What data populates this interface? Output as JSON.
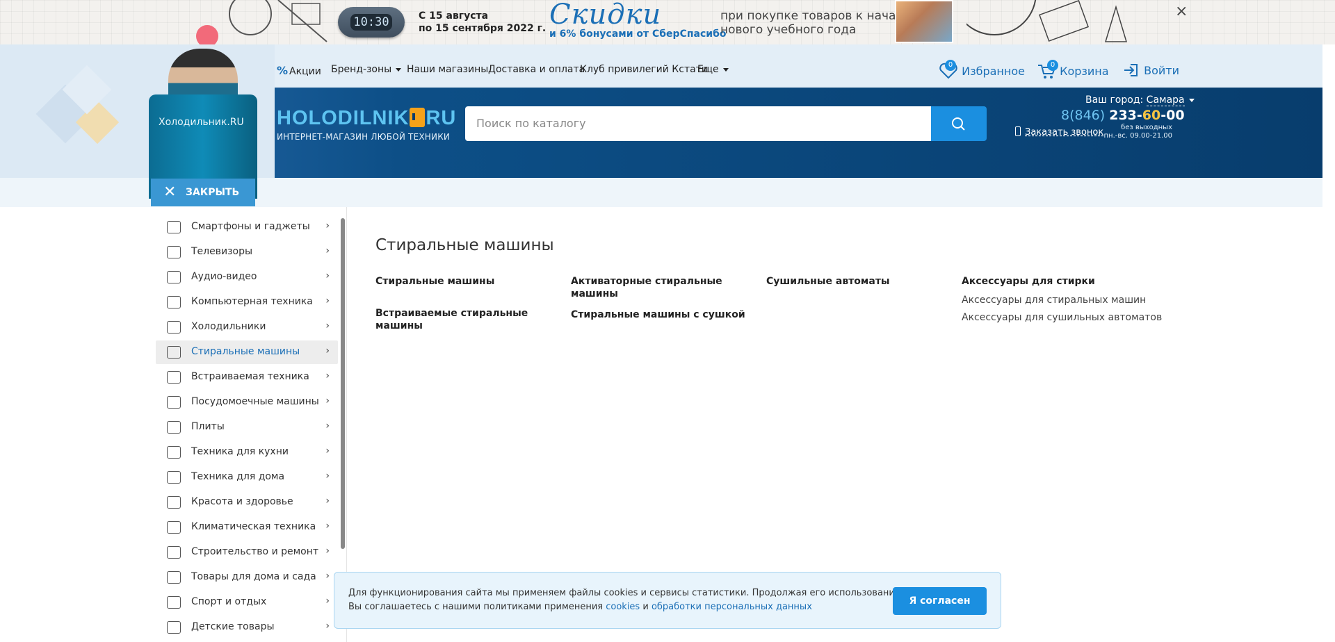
{
  "promo": {
    "clock_time": "10:30",
    "dates_line1": "С 15 августа",
    "dates_line2": "по 15 сентября 2022 г.",
    "sale_word": "Скидки",
    "bonus_text": "и 6% бонусами от СберСпасибо",
    "note_line1": "при покупке товаров к началу",
    "note_line2": "нового учебного года",
    "close": "×"
  },
  "illustration": {
    "fridge_label": "Холодильник.RU"
  },
  "topnav": {
    "items": [
      {
        "label": "Акции",
        "icon": "percent-icon"
      },
      {
        "label": "Бренд-зоны",
        "dropdown": true
      },
      {
        "label": "Наши магазины"
      },
      {
        "label": "Доставка и оплата"
      },
      {
        "label": "Клуб привилегий Кстати"
      },
      {
        "label": "Еще",
        "dropdown": true
      }
    ]
  },
  "account": {
    "favorites_label": "Избранное",
    "favorites_count": "0",
    "cart_label": "Корзина",
    "cart_count": "0",
    "login_label": "Войти"
  },
  "brand": {
    "logo_left": "HOLODILNIK",
    "logo_right": "RU",
    "tagline": "ИНТЕРНЕТ-МАГАЗИН ЛЮБОЙ ТЕХНИКИ"
  },
  "search": {
    "placeholder": "Поиск по каталогу"
  },
  "contact": {
    "city_label": "Ваш город:",
    "city_value": "Самара",
    "phone_code": "8(846)",
    "phone_a": "233-",
    "phone_b": "60",
    "phone_c": "-00",
    "callback": "Заказать звонок",
    "hours_line1": "без выходных",
    "hours_line2": "пн.-вс. 09.00-21.00"
  },
  "close_tab": {
    "label": "ЗАКРЫТЬ"
  },
  "sidebar": {
    "items": [
      {
        "label": "Смартфоны и гаджеты",
        "icon": "smartphone-icon"
      },
      {
        "label": "Телевизоры",
        "icon": "tv-icon"
      },
      {
        "label": "Аудио-видео",
        "icon": "speaker-icon"
      },
      {
        "label": "Компьютерная техника",
        "icon": "laptop-icon"
      },
      {
        "label": "Холодильники",
        "icon": "fridge-icon"
      },
      {
        "label": "Стиральные машины",
        "icon": "washer-icon",
        "active": true
      },
      {
        "label": "Встраиваемая техника",
        "icon": "builtin-icon"
      },
      {
        "label": "Посудомоечные машины",
        "icon": "dishwasher-icon"
      },
      {
        "label": "Плиты",
        "icon": "stove-icon"
      },
      {
        "label": "Техника для кухни",
        "icon": "kitchen-icon"
      },
      {
        "label": "Техника для дома",
        "icon": "iron-icon"
      },
      {
        "label": "Красота и здоровье",
        "icon": "hairdryer-icon"
      },
      {
        "label": "Климатическая техника",
        "icon": "aircon-icon"
      },
      {
        "label": "Строительство и ремонт",
        "icon": "drill-icon"
      },
      {
        "label": "Товары для дома и сада",
        "icon": "wheelbarrow-icon"
      },
      {
        "label": "Спорт и отдых",
        "icon": "dumbbell-icon"
      },
      {
        "label": "Детские товары",
        "icon": "stroller-icon"
      }
    ]
  },
  "content": {
    "title": "Стиральные машины",
    "col1": [
      "Стиральные машины",
      "Встраиваемые стиральные машины"
    ],
    "col2": [
      "Активаторные стиральные машины",
      "Стиральные машины с сушкой"
    ],
    "col3": [
      "Сушильные автоматы"
    ],
    "col4_title": "Аксессуары для стирки",
    "col4_links": [
      "Аксессуары для стиральных машин",
      "Аксессуары для сушильных автоматов"
    ]
  },
  "cookie": {
    "line1": "Для функционирования сайта мы применяем файлы cookies и сервисы статистики. Продолжая его использование,",
    "line2_prefix": "Вы соглашаетесь с нашими политиками применения",
    "link1": "cookies",
    "and": "и",
    "link2": "обработки персональных данных",
    "accept": "Я согласен"
  },
  "colors": {
    "accent": "#1b8fe0",
    "header_dark": "#083d6d",
    "logo_blue": "#5ec4f1",
    "logo_orange": "#f5a21a"
  }
}
